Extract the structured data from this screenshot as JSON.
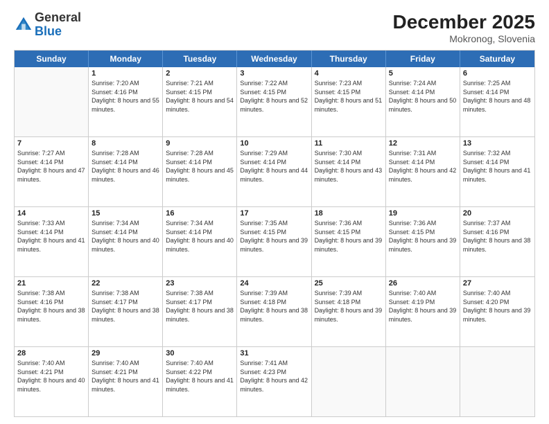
{
  "logo": {
    "general": "General",
    "blue": "Blue"
  },
  "title": "December 2025",
  "subtitle": "Mokronog, Slovenia",
  "weekdays": [
    "Sunday",
    "Monday",
    "Tuesday",
    "Wednesday",
    "Thursday",
    "Friday",
    "Saturday"
  ],
  "weeks": [
    [
      {
        "day": "",
        "empty": true
      },
      {
        "day": "1",
        "sunrise": "7:20 AM",
        "sunset": "4:16 PM",
        "daylight": "8 hours and 55 minutes."
      },
      {
        "day": "2",
        "sunrise": "7:21 AM",
        "sunset": "4:15 PM",
        "daylight": "8 hours and 54 minutes."
      },
      {
        "day": "3",
        "sunrise": "7:22 AM",
        "sunset": "4:15 PM",
        "daylight": "8 hours and 52 minutes."
      },
      {
        "day": "4",
        "sunrise": "7:23 AM",
        "sunset": "4:15 PM",
        "daylight": "8 hours and 51 minutes."
      },
      {
        "day": "5",
        "sunrise": "7:24 AM",
        "sunset": "4:14 PM",
        "daylight": "8 hours and 50 minutes."
      },
      {
        "day": "6",
        "sunrise": "7:25 AM",
        "sunset": "4:14 PM",
        "daylight": "8 hours and 48 minutes."
      }
    ],
    [
      {
        "day": "7",
        "sunrise": "7:27 AM",
        "sunset": "4:14 PM",
        "daylight": "8 hours and 47 minutes."
      },
      {
        "day": "8",
        "sunrise": "7:28 AM",
        "sunset": "4:14 PM",
        "daylight": "8 hours and 46 minutes."
      },
      {
        "day": "9",
        "sunrise": "7:28 AM",
        "sunset": "4:14 PM",
        "daylight": "8 hours and 45 minutes."
      },
      {
        "day": "10",
        "sunrise": "7:29 AM",
        "sunset": "4:14 PM",
        "daylight": "8 hours and 44 minutes."
      },
      {
        "day": "11",
        "sunrise": "7:30 AM",
        "sunset": "4:14 PM",
        "daylight": "8 hours and 43 minutes."
      },
      {
        "day": "12",
        "sunrise": "7:31 AM",
        "sunset": "4:14 PM",
        "daylight": "8 hours and 42 minutes."
      },
      {
        "day": "13",
        "sunrise": "7:32 AM",
        "sunset": "4:14 PM",
        "daylight": "8 hours and 41 minutes."
      }
    ],
    [
      {
        "day": "14",
        "sunrise": "7:33 AM",
        "sunset": "4:14 PM",
        "daylight": "8 hours and 41 minutes."
      },
      {
        "day": "15",
        "sunrise": "7:34 AM",
        "sunset": "4:14 PM",
        "daylight": "8 hours and 40 minutes."
      },
      {
        "day": "16",
        "sunrise": "7:34 AM",
        "sunset": "4:14 PM",
        "daylight": "8 hours and 40 minutes."
      },
      {
        "day": "17",
        "sunrise": "7:35 AM",
        "sunset": "4:15 PM",
        "daylight": "8 hours and 39 minutes."
      },
      {
        "day": "18",
        "sunrise": "7:36 AM",
        "sunset": "4:15 PM",
        "daylight": "8 hours and 39 minutes."
      },
      {
        "day": "19",
        "sunrise": "7:36 AM",
        "sunset": "4:15 PM",
        "daylight": "8 hours and 39 minutes."
      },
      {
        "day": "20",
        "sunrise": "7:37 AM",
        "sunset": "4:16 PM",
        "daylight": "8 hours and 38 minutes."
      }
    ],
    [
      {
        "day": "21",
        "sunrise": "7:38 AM",
        "sunset": "4:16 PM",
        "daylight": "8 hours and 38 minutes."
      },
      {
        "day": "22",
        "sunrise": "7:38 AM",
        "sunset": "4:17 PM",
        "daylight": "8 hours and 38 minutes."
      },
      {
        "day": "23",
        "sunrise": "7:38 AM",
        "sunset": "4:17 PM",
        "daylight": "8 hours and 38 minutes."
      },
      {
        "day": "24",
        "sunrise": "7:39 AM",
        "sunset": "4:18 PM",
        "daylight": "8 hours and 38 minutes."
      },
      {
        "day": "25",
        "sunrise": "7:39 AM",
        "sunset": "4:18 PM",
        "daylight": "8 hours and 39 minutes."
      },
      {
        "day": "26",
        "sunrise": "7:40 AM",
        "sunset": "4:19 PM",
        "daylight": "8 hours and 39 minutes."
      },
      {
        "day": "27",
        "sunrise": "7:40 AM",
        "sunset": "4:20 PM",
        "daylight": "8 hours and 39 minutes."
      }
    ],
    [
      {
        "day": "28",
        "sunrise": "7:40 AM",
        "sunset": "4:21 PM",
        "daylight": "8 hours and 40 minutes."
      },
      {
        "day": "29",
        "sunrise": "7:40 AM",
        "sunset": "4:21 PM",
        "daylight": "8 hours and 41 minutes."
      },
      {
        "day": "30",
        "sunrise": "7:40 AM",
        "sunset": "4:22 PM",
        "daylight": "8 hours and 41 minutes."
      },
      {
        "day": "31",
        "sunrise": "7:41 AM",
        "sunset": "4:23 PM",
        "daylight": "8 hours and 42 minutes."
      },
      {
        "day": "",
        "empty": true
      },
      {
        "day": "",
        "empty": true
      },
      {
        "day": "",
        "empty": true
      }
    ]
  ]
}
